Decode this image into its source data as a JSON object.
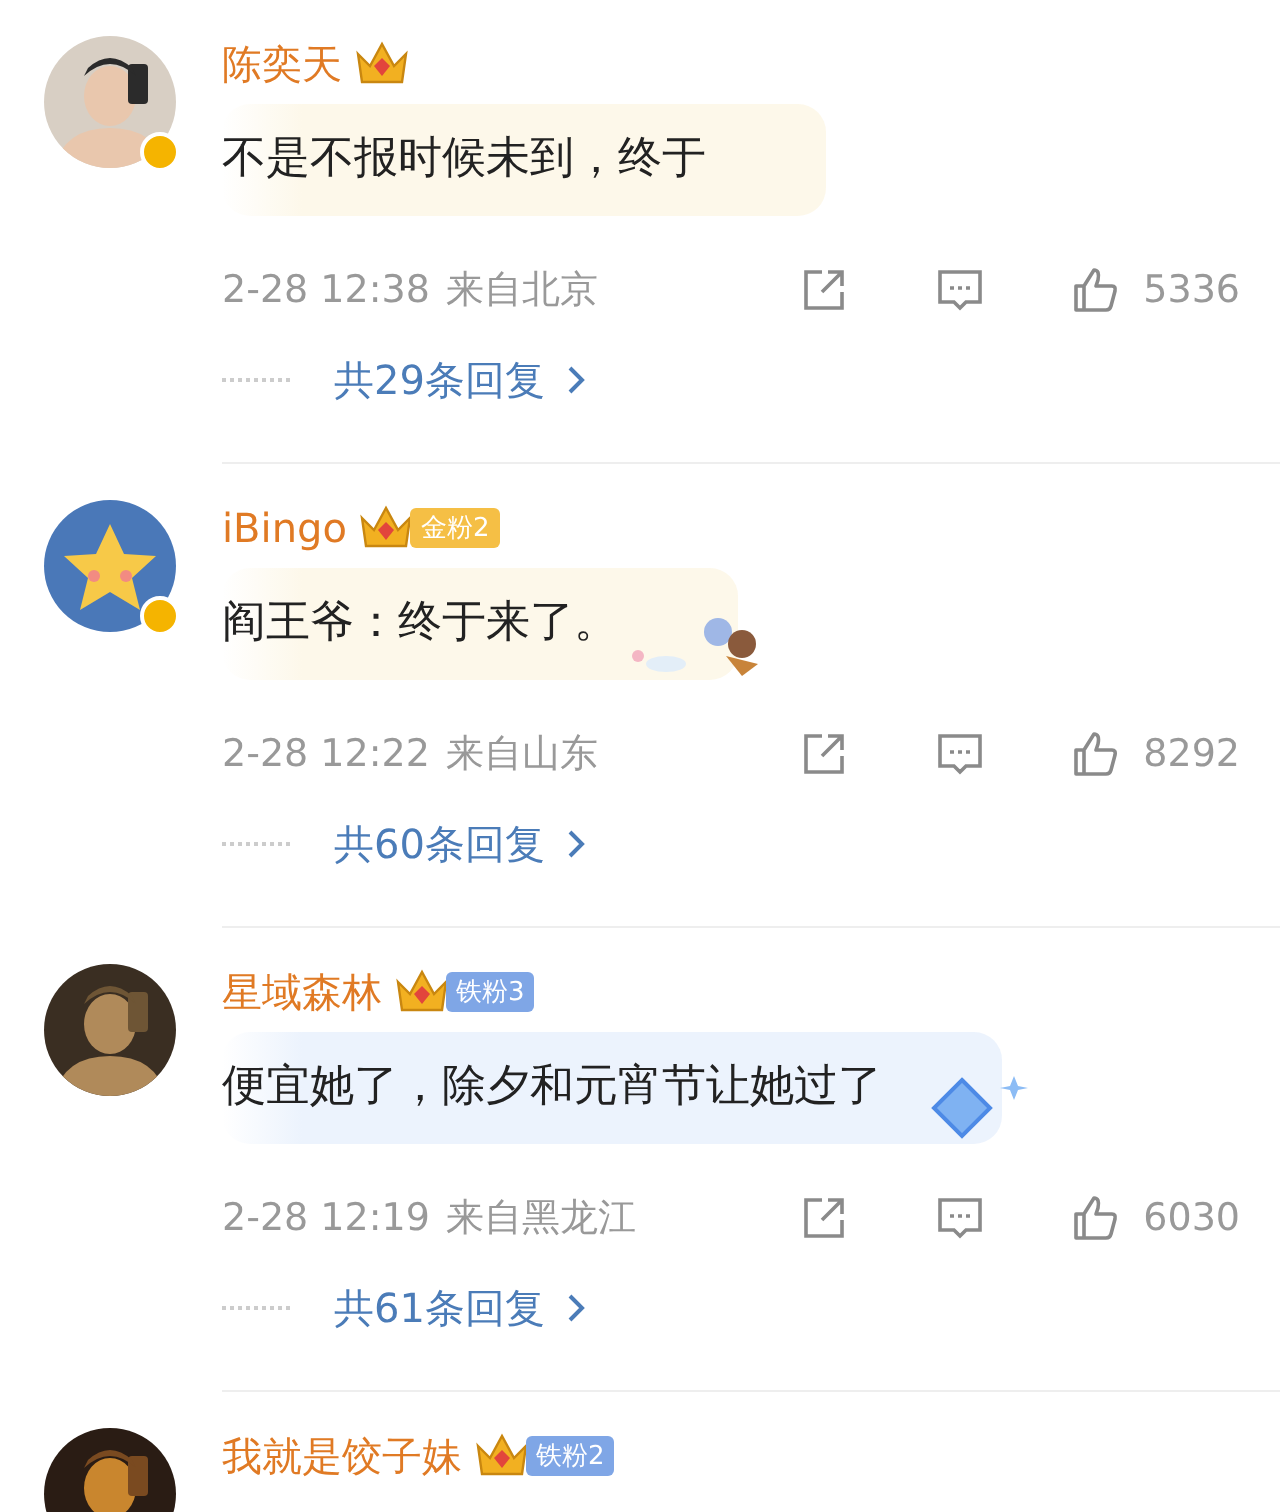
{
  "comments": [
    {
      "user": "陈奕天",
      "verified": true,
      "text": "不是不报时候未到，终于",
      "bubble": {
        "kind": "plain",
        "color": "#fdf8ea"
      },
      "time": "2-28 12:38",
      "location": "来自北京",
      "likes": "5336",
      "replies": "共29条回复"
    },
    {
      "user": "iBingo",
      "verified": true,
      "fan_badge": {
        "kind": "gold",
        "label": "金粉2"
      },
      "text": "阎王爷：终于来了。",
      "bubble": {
        "kind": "cartoon",
        "color": "#fdf8ea"
      },
      "time": "2-28 12:22",
      "location": "来自山东",
      "likes": "8292",
      "replies": "共60条回复"
    },
    {
      "user": "星域森林",
      "verified": false,
      "fan_badge": {
        "kind": "iron",
        "label": "铁粉3"
      },
      "text": "便宜她了，除夕和元宵节让她过了",
      "bubble": {
        "kind": "diamond",
        "color": "#ecf3fd"
      },
      "time": "2-28 12:19",
      "location": "来自黑龙江",
      "likes": "6030",
      "replies": "共61条回复"
    },
    {
      "user": "我就是饺子妹",
      "verified": false,
      "fan_badge": {
        "kind": "iron",
        "label": "铁粉2"
      }
    }
  ]
}
